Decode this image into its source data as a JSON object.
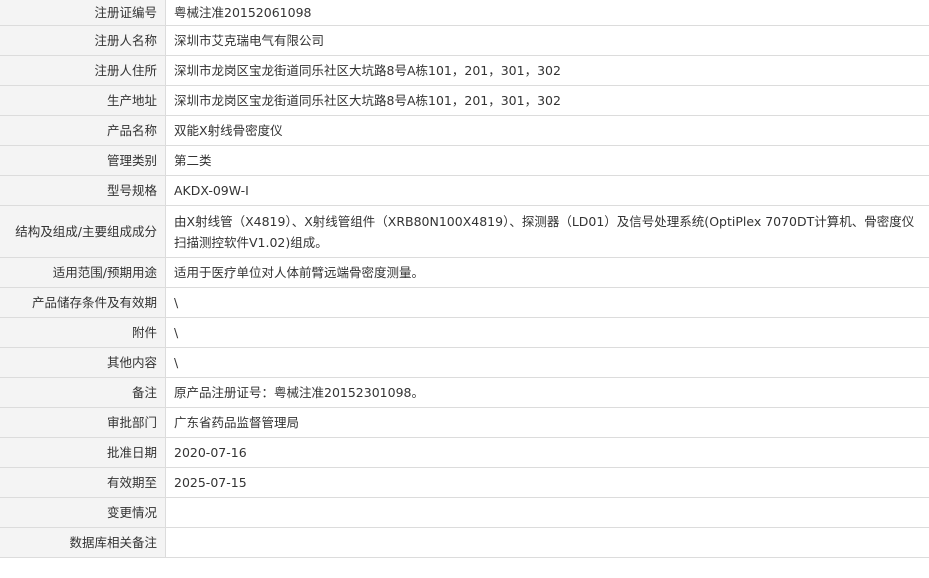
{
  "rows": [
    {
      "label": "注册证编号",
      "value": "粤械注准20152061098"
    },
    {
      "label": "注册人名称",
      "value": "深圳市艾克瑞电气有限公司"
    },
    {
      "label": "注册人住所",
      "value": "深圳市龙岗区宝龙街道同乐社区大坑路8号A栋101，201，301，302"
    },
    {
      "label": "生产地址",
      "value": "深圳市龙岗区宝龙街道同乐社区大坑路8号A栋101，201，301，302"
    },
    {
      "label": "产品名称",
      "value": "双能X射线骨密度仪"
    },
    {
      "label": "管理类别",
      "value": "第二类"
    },
    {
      "label": "型号规格",
      "value": "AKDX-09W-I"
    },
    {
      "label": "结构及组成/主要组成成分",
      "value": "由X射线管（X4819）、X射线管组件（XRB80N100X4819）、探测器（LD01）及信号处理系统(OptiPlex 7070DT计算机、骨密度仪扫描测控软件V1.02)组成。"
    },
    {
      "label": "适用范围/预期用途",
      "value": "适用于医疗单位对人体前臂远端骨密度测量。"
    },
    {
      "label": "产品储存条件及有效期",
      "value": "\\"
    },
    {
      "label": "附件",
      "value": "\\"
    },
    {
      "label": "其他内容",
      "value": "\\"
    },
    {
      "label": "备注",
      "value": "原产品注册证号：粤械注准20152301098。"
    },
    {
      "label": "审批部门",
      "value": "广东省药品监督管理局"
    },
    {
      "label": "批准日期",
      "value": "2020-07-16"
    },
    {
      "label": "有效期至",
      "value": "2025-07-15"
    },
    {
      "label": "变更情况",
      "value": ""
    },
    {
      "label": "数据库相关备注",
      "value": ""
    }
  ]
}
